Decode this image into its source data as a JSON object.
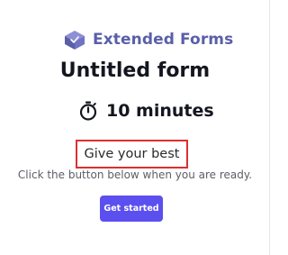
{
  "brand": {
    "name": "Extended Forms",
    "icon": "extended-forms-logo-icon",
    "color": "#5a5fa8"
  },
  "form": {
    "title": "Untitled form"
  },
  "timer": {
    "icon": "stopwatch-icon",
    "label": "10 minutes"
  },
  "callout": {
    "text": "Give your best",
    "border_color": "#dc2f2f"
  },
  "instruction": "Click the button below when you are ready.",
  "start_button": {
    "label": "Get started",
    "color": "#5b4ff0"
  }
}
